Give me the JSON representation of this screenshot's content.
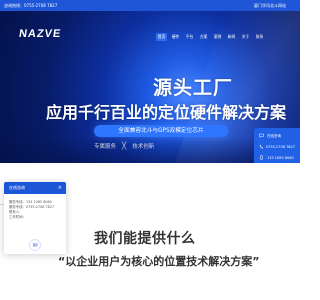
{
  "topbar": {
    "left": "咨询热线：0755-2708 7827",
    "right": "厦门华讯北斗网站"
  },
  "brand": {
    "logo": "NAZVE"
  },
  "nav": {
    "items": [
      {
        "label": "首页",
        "active": true
      },
      {
        "label": "硬件",
        "active": false
      },
      {
        "label": "平台",
        "active": false
      },
      {
        "label": "方案",
        "active": false
      },
      {
        "label": "案例",
        "active": false
      },
      {
        "label": "新闻",
        "active": false
      },
      {
        "label": "关于",
        "active": false
      },
      {
        "label": "联系",
        "active": false
      }
    ]
  },
  "hero": {
    "title": "源头工厂",
    "subtitle": "应用千行百业的定位硬件解决方案",
    "pill": "全面兼容北斗与GPS双模定位芯片",
    "tag_left": "专属服务",
    "tag_sep": "╳",
    "tag_right": "技术创新"
  },
  "float_contact": {
    "items": [
      {
        "icon": "chat-icon",
        "label": "在线咨询"
      },
      {
        "icon": "phone-icon",
        "label": "0755-2708 7827"
      },
      {
        "icon": "mobile-icon",
        "label": "133 1085 8060"
      }
    ]
  },
  "popup": {
    "header": "在线咨询",
    "close": "×",
    "rows": [
      "服务专线：133 1085 8060",
      "服务专线：0755-2708 7827",
      "联系人：",
      "工作时间："
    ],
    "icon": "chat-icon"
  },
  "section": {
    "title": "我们能提供什么",
    "subtitle": "“以企业用户为核心的位置技术解决方案”"
  }
}
